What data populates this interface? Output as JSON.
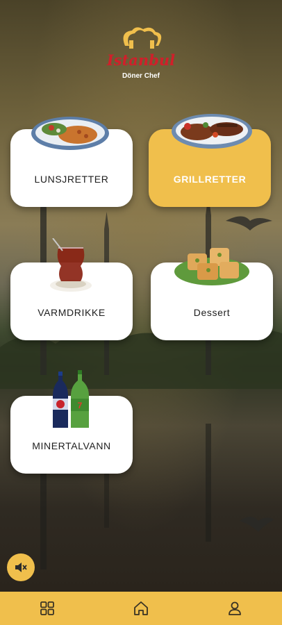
{
  "brand": {
    "name": "Istanbul",
    "tagline": "Döner Chef"
  },
  "categories": [
    {
      "label": "LUNSJRETTER",
      "active": false
    },
    {
      "label": "GRILLRETTER",
      "active": true
    },
    {
      "label": "VARMDRIKKE",
      "active": false
    },
    {
      "label": "Dessert",
      "active": false
    },
    {
      "label": "MINERTALVANN",
      "active": false
    }
  ],
  "bottom_nav": [
    "grid-icon",
    "home-icon",
    "user-icon"
  ],
  "colors": {
    "accent": "#f0bf4c",
    "brand_red": "#d11f2a",
    "card": "#ffffff"
  }
}
